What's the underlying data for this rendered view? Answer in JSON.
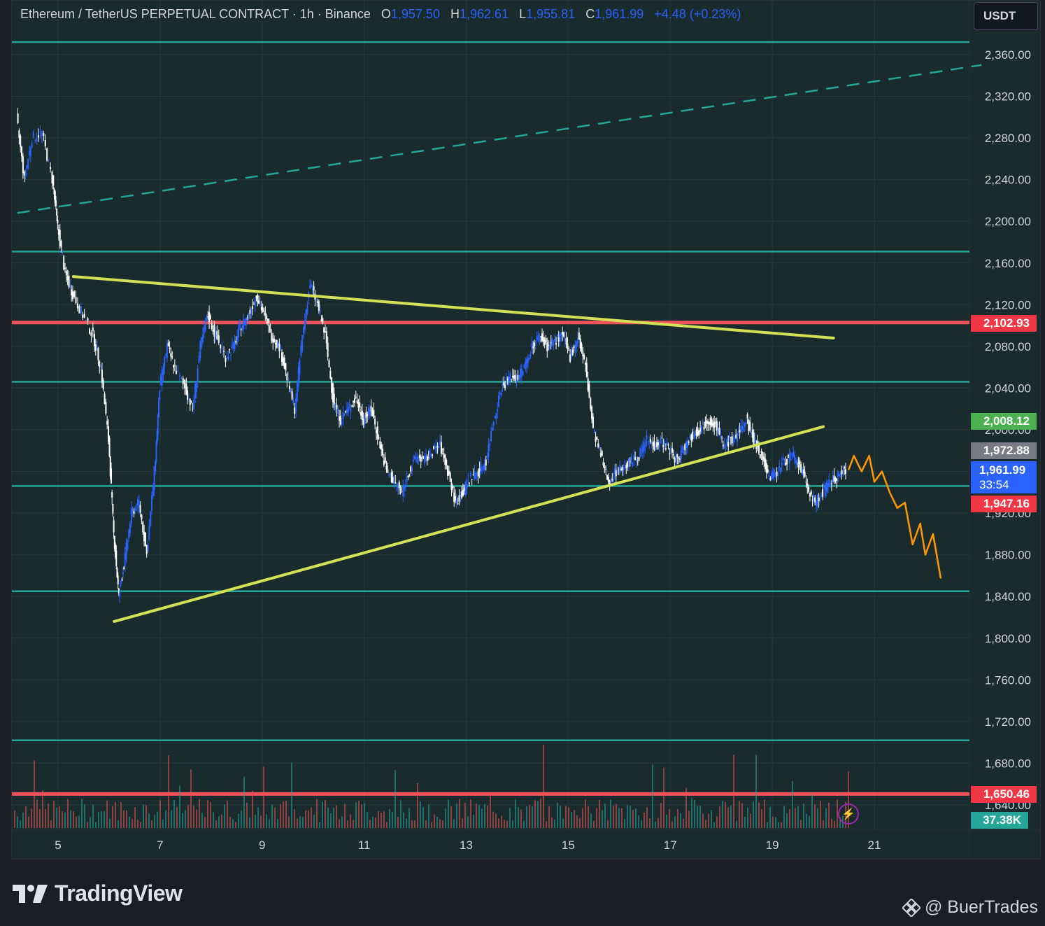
{
  "header": {
    "symbol": "Ethereum / TetherUS PERPETUAL CONTRACT · 1h · Binance",
    "open_label": "O",
    "open": "1,957.50",
    "high_label": "H",
    "high": "1,962.61",
    "low_label": "L",
    "low": "1,955.81",
    "close_label": "C",
    "close": "1,961.99",
    "change": "+4.48 (+0.23%)"
  },
  "currency_button": "USDT",
  "price_tags": {
    "resistance": "2,102.93",
    "green": "2,008.12",
    "gray": "1,972.88",
    "current": "1,961.99",
    "countdown": "33:54",
    "red_mid": "1,947.16",
    "support": "1,650.46",
    "volume": "37.38K"
  },
  "branding": {
    "logo_text": "TradingView",
    "watermark": "@ BuerTrades"
  },
  "colors": {
    "background": "#1a2b2d",
    "horizontal_levels": "#26a69a",
    "red_levels": "#f0545a",
    "trendlines": "#d4e157",
    "candles_up": "#2962ff",
    "candles_down": "#ffffff",
    "projection": "#ff9800",
    "tag_green": "#4caf50",
    "tag_gray": "#787b86",
    "tag_blue": "#2962ff",
    "tag_red": "#f23645",
    "tag_teal": "#26a69a"
  },
  "chart_data": {
    "type": "candlestick",
    "title": "Ethereum / TetherUS PERPETUAL CONTRACT · 1h · Binance",
    "x_tick_labels": [
      "5",
      "7",
      "9",
      "11",
      "13",
      "15",
      "17",
      "19",
      "21"
    ],
    "y_tick_labels": [
      "2,360.00",
      "2,320.00",
      "2,280.00",
      "2,240.00",
      "2,200.00",
      "2,160.00",
      "2,120.00",
      "2,080.00",
      "2,040.00",
      "2,000.00",
      "1,960.00",
      "1,920.00",
      "1,880.00",
      "1,840.00",
      "1,800.00",
      "1,760.00",
      "1,720.00",
      "1,680.00",
      "1,640.00"
    ],
    "y_range": [
      1625,
      2370
    ],
    "x_range_days": [
      4.2,
      23.4
    ],
    "grid": true,
    "horizontal_levels": [
      2372,
      2171,
      2046,
      1946,
      1845,
      1702
    ],
    "red_levels": [
      2102.93,
      1650.46
    ],
    "trendlines": [
      {
        "from": {
          "day": 5.3,
          "price": 2147
        },
        "to": {
          "day": 20.2,
          "price": 2088
        }
      },
      {
        "from": {
          "day": 6.1,
          "price": 1816
        },
        "to": {
          "day": 20.0,
          "price": 2003
        }
      }
    ],
    "dashed_trendline": {
      "from": {
        "day": 4.2,
        "price": 2208
      },
      "to": {
        "day": 23.1,
        "price": 2350
      }
    },
    "close_path": [
      [
        4.2,
        2300
      ],
      [
        4.35,
        2240
      ],
      [
        4.5,
        2280
      ],
      [
        4.7,
        2285
      ],
      [
        4.9,
        2240
      ],
      [
        5.0,
        2195
      ],
      [
        5.15,
        2150
      ],
      [
        5.3,
        2130
      ],
      [
        5.5,
        2110
      ],
      [
        5.7,
        2090
      ],
      [
        5.85,
        2060
      ],
      [
        6.0,
        1990
      ],
      [
        6.1,
        1900
      ],
      [
        6.2,
        1840
      ],
      [
        6.3,
        1870
      ],
      [
        6.45,
        1920
      ],
      [
        6.6,
        1930
      ],
      [
        6.75,
        1880
      ],
      [
        6.9,
        1960
      ],
      [
        7.0,
        2040
      ],
      [
        7.15,
        2080
      ],
      [
        7.3,
        2060
      ],
      [
        7.5,
        2040
      ],
      [
        7.65,
        2020
      ],
      [
        7.8,
        2080
      ],
      [
        7.95,
        2110
      ],
      [
        8.1,
        2090
      ],
      [
        8.3,
        2070
      ],
      [
        8.45,
        2080
      ],
      [
        8.6,
        2100
      ],
      [
        8.75,
        2110
      ],
      [
        8.9,
        2130
      ],
      [
        9.05,
        2110
      ],
      [
        9.2,
        2090
      ],
      [
        9.35,
        2080
      ],
      [
        9.5,
        2050
      ],
      [
        9.65,
        2020
      ],
      [
        9.8,
        2090
      ],
      [
        9.95,
        2140
      ],
      [
        10.1,
        2120
      ],
      [
        10.25,
        2090
      ],
      [
        10.4,
        2030
      ],
      [
        10.55,
        2010
      ],
      [
        10.7,
        2020
      ],
      [
        10.85,
        2030
      ],
      [
        11.0,
        2010
      ],
      [
        11.15,
        2020
      ],
      [
        11.3,
        1990
      ],
      [
        11.45,
        1960
      ],
      [
        11.6,
        1950
      ],
      [
        11.75,
        1940
      ],
      [
        11.9,
        1960
      ],
      [
        12.05,
        1975
      ],
      [
        12.2,
        1970
      ],
      [
        12.35,
        1980
      ],
      [
        12.5,
        1985
      ],
      [
        12.65,
        1960
      ],
      [
        12.8,
        1930
      ],
      [
        12.95,
        1940
      ],
      [
        13.1,
        1955
      ],
      [
        13.25,
        1960
      ],
      [
        13.4,
        1970
      ],
      [
        13.55,
        2010
      ],
      [
        13.7,
        2040
      ],
      [
        13.85,
        2050
      ],
      [
        14.0,
        2050
      ],
      [
        14.15,
        2060
      ],
      [
        14.3,
        2080
      ],
      [
        14.45,
        2090
      ],
      [
        14.6,
        2080
      ],
      [
        14.75,
        2085
      ],
      [
        14.9,
        2090
      ],
      [
        15.05,
        2070
      ],
      [
        15.2,
        2090
      ],
      [
        15.35,
        2060
      ],
      [
        15.5,
        2000
      ],
      [
        15.65,
        1975
      ],
      [
        15.8,
        1950
      ],
      [
        15.95,
        1960
      ],
      [
        16.1,
        1965
      ],
      [
        16.25,
        1970
      ],
      [
        16.4,
        1975
      ],
      [
        16.55,
        1990
      ],
      [
        16.7,
        1985
      ],
      [
        16.85,
        1990
      ],
      [
        17.0,
        1980
      ],
      [
        17.15,
        1970
      ],
      [
        17.3,
        1985
      ],
      [
        17.45,
        1995
      ],
      [
        17.6,
        2000
      ],
      [
        17.75,
        2010
      ],
      [
        17.9,
        2005
      ],
      [
        18.05,
        1985
      ],
      [
        18.2,
        1990
      ],
      [
        18.35,
        1995
      ],
      [
        18.5,
        2010
      ],
      [
        18.65,
        1990
      ],
      [
        18.8,
        1975
      ],
      [
        18.95,
        1955
      ],
      [
        19.1,
        1960
      ],
      [
        19.25,
        1970
      ],
      [
        19.4,
        1975
      ],
      [
        19.55,
        1965
      ],
      [
        19.7,
        1945
      ],
      [
        19.85,
        1930
      ],
      [
        20.0,
        1940
      ],
      [
        20.15,
        1950
      ],
      [
        20.3,
        1955
      ],
      [
        20.45,
        1962
      ]
    ],
    "projection_path": [
      [
        20.5,
        1962
      ],
      [
        20.6,
        1975
      ],
      [
        20.75,
        1960
      ],
      [
        20.9,
        1975
      ],
      [
        21.0,
        1950
      ],
      [
        21.15,
        1960
      ],
      [
        21.3,
        1940
      ],
      [
        21.45,
        1925
      ],
      [
        21.6,
        1930
      ],
      [
        21.75,
        1890
      ],
      [
        21.9,
        1910
      ],
      [
        22.0,
        1880
      ],
      [
        22.15,
        1900
      ],
      [
        22.3,
        1858
      ]
    ],
    "volume_range": [
      0,
      300
    ]
  }
}
